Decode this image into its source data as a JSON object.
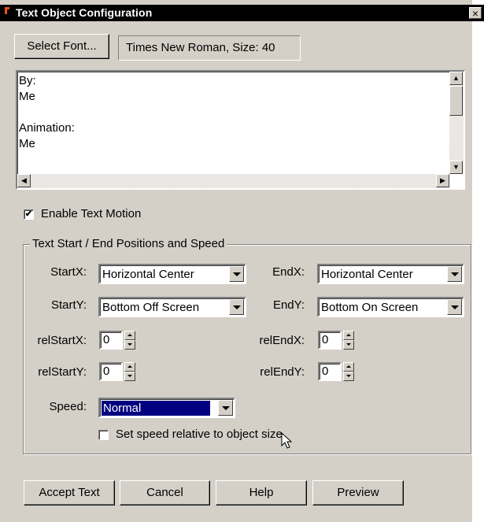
{
  "window": {
    "title": "Text Object Configuration",
    "close_glyph": "×"
  },
  "font": {
    "select_label": "Select Font...",
    "display": "Times New Roman, Size: 40"
  },
  "textarea": {
    "content": "By:\nMe\n\nAnimation:\nMe"
  },
  "motion": {
    "enable_label": "Enable Text Motion",
    "enabled": true
  },
  "group": {
    "title": "Text Start / End Positions and Speed",
    "startx_label": "StartX:",
    "startx_value": "Horizontal Center",
    "endx_label": "EndX:",
    "endx_value": "Horizontal Center",
    "starty_label": "StartY:",
    "starty_value": "Bottom Off Screen",
    "endy_label": "EndY:",
    "endy_value": "Bottom On Screen",
    "relstartx_label": "relStartX:",
    "relstartx_value": "0",
    "relendx_label": "relEndX:",
    "relendx_value": "0",
    "relstarty_label": "relStartY:",
    "relstarty_value": "0",
    "relendy_label": "relEndY:",
    "relendy_value": "0",
    "speed_label": "Speed:",
    "speed_value": "Normal",
    "relative_label": "Set speed relative to object size",
    "relative_checked": false
  },
  "buttons": {
    "accept": "Accept Text",
    "cancel": "Cancel",
    "help": "Help",
    "preview": "Preview"
  },
  "icons": {
    "title_icon": "app-icon",
    "close": "close-icon",
    "cursor": "mouse-pointer-icon"
  },
  "colors": {
    "face": "#d4d0c8",
    "titlebar": "#000000",
    "selection": "#000080"
  }
}
